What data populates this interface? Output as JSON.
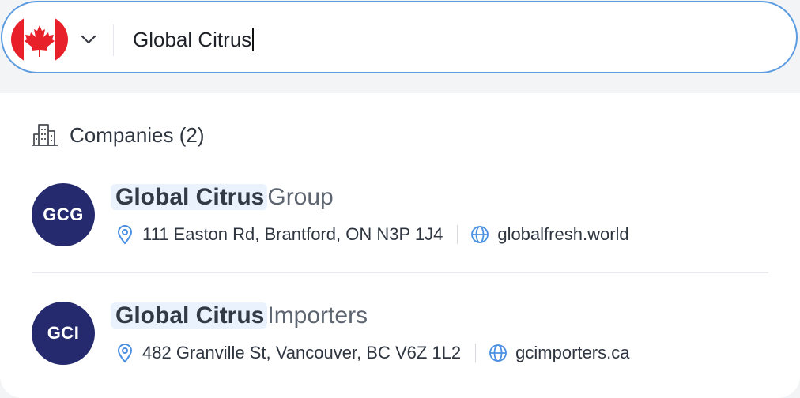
{
  "search": {
    "country_flag": "canada-flag",
    "query": "Global Citrus"
  },
  "results": {
    "section_title": "Companies (2)",
    "companies": [
      {
        "initials": "GCG",
        "name_match": "Global Citrus",
        "name_rest": "Group",
        "address": "111 Easton Rd, Brantford, ON N3P 1J4",
        "website": "globalfresh.world"
      },
      {
        "initials": "GCI",
        "name_match": "Global Citrus",
        "name_rest": "Importers",
        "address": "482 Granville St, Vancouver, BC V6Z 1L2",
        "website": "gcimporters.ca"
      }
    ]
  },
  "colors": {
    "accent": "#5b9be0",
    "avatar_bg": "#252a6e",
    "highlight_bg": "#eaf3fd",
    "icon_blue": "#4a90e2"
  }
}
